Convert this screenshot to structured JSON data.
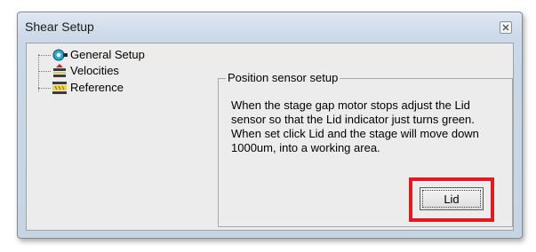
{
  "window": {
    "title": "Shear Setup",
    "close_icon": "close-icon"
  },
  "tree": {
    "items": [
      {
        "label": "General Setup",
        "icon": "general-setup-icon"
      },
      {
        "label": "Velocities",
        "icon": "velocities-icon"
      },
      {
        "label": "Reference",
        "icon": "reference-icon"
      }
    ]
  },
  "panel": {
    "group_title": "Position sensor setup",
    "description": "When the stage gap motor stops adjust the Lid sensor so that the Lid indicator just turns green. When set click Lid and the stage will move down 1000um, into a working area.",
    "lid_button_label": "Lid"
  },
  "colors": {
    "highlight": "#e3191f"
  }
}
